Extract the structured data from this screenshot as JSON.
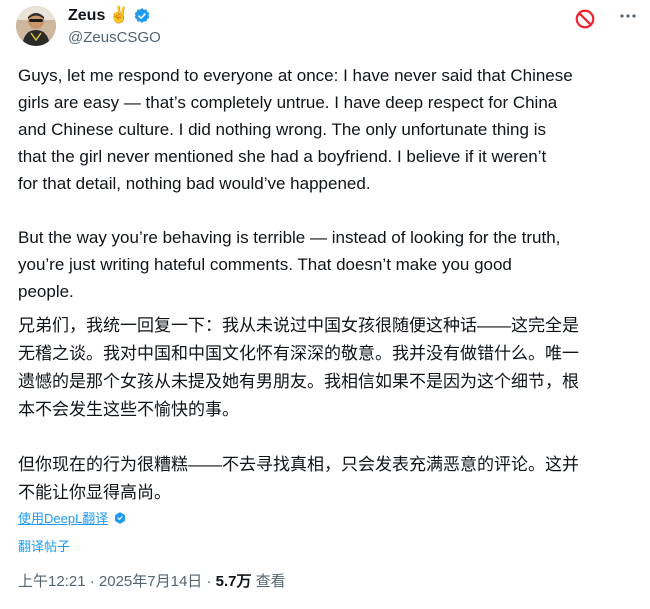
{
  "author": {
    "name": "Zeus",
    "emoji": "✌️",
    "handle": "@ZeusCSGO"
  },
  "tweet": {
    "paragraphs": [
      "Guys, let me respond to everyone at once: I have never said that Chinese\ngirls are easy — that’s completely untrue. I have deep respect for China\nand Chinese culture. I did nothing wrong. The only unfortunate thing is\nthat the girl never mentioned she had a boyfriend. I believe if it weren’t\nfor that detail, nothing bad would’ve happened.",
      "But the way you’re behaving is terrible — instead of looking for the truth,\nyou’re just writing hateful comments. That doesn’t make you good\npeople.",
      "兄弟们，我统一回复一下：我从未说过中国女孩很随便这种话——这完全是\n无稽之谈。我对中国和中国文化怀有深深的敬意。我并没有做错什么。唯一\n遗憾的是那个女孩从未提及她有男朋友。我相信如果不是因为这个细节，根\n本不会发生这些不愉快的事。",
      "但你现在的行为很糟糕——不去寻找真相，只会发表充满恶意的评论。这并\n不能让你显得高尚。"
    ]
  },
  "translation": {
    "provider_label": "使用DeepL翻译",
    "translate_post": "翻译帖子"
  },
  "meta": {
    "time": "上午12:21",
    "separator1": "·",
    "date": "2025年7月14日",
    "separator2": "·",
    "views_count": "5.7万",
    "views_label": "查看"
  },
  "colors": {
    "verified": "#1d9bf0",
    "block": "#f4212e",
    "link": "#1d9bf0",
    "muted": "#536471"
  }
}
